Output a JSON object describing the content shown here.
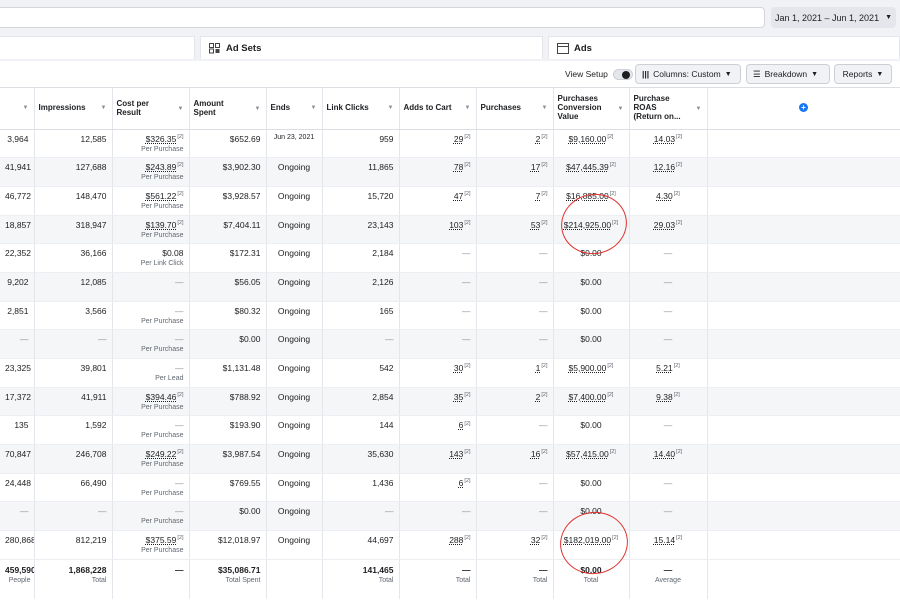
{
  "date_range": "Jan 1, 2021 – Jun 1, 2021",
  "tabs": {
    "ad_sets": "Ad Sets",
    "ads": "Ads"
  },
  "toolbar": {
    "view_setup": "View Setup",
    "columns": "Columns: Custom",
    "breakdown": "Breakdown",
    "reports": "Reports"
  },
  "headers": [
    "Impressions",
    "Cost per Result",
    "Amount Spent",
    "Ends",
    "Link Clicks",
    "Adds to Cart",
    "Purchases",
    "Purchases Conversion Value",
    "Purchase ROAS (Return on..."
  ],
  "rows": [
    {
      "reach": "3,964",
      "impr": "12,585",
      "cost": "$326.35",
      "cost_sup": "[2]",
      "cost_sub": "Per Purchase",
      "spent": "$652.69",
      "ends": "Jun 23, 2021",
      "clicks": "959",
      "atc": "29",
      "atc_sup": "[2]",
      "purch": "2",
      "purch_sup": "[2]",
      "pcv": "$9,160.00",
      "pcv_sup": "[2]",
      "roas": "14.03",
      "roas_sup": "[2]"
    },
    {
      "reach": "41,941",
      "impr": "127,688",
      "cost": "$243.89",
      "cost_sup": "[2]",
      "cost_sub": "Per Purchase",
      "spent": "$3,902.30",
      "ends": "Ongoing",
      "clicks": "11,865",
      "atc": "78",
      "atc_sup": "[2]",
      "purch": "17",
      "purch_sup": "[2]",
      "pcv": "$47,445.39",
      "pcv_sup": "[2]",
      "roas": "12.16",
      "roas_sup": "[2]"
    },
    {
      "reach": "46,772",
      "impr": "148,470",
      "cost": "$561.22",
      "cost_sup": "[2]",
      "cost_sub": "Per Purchase",
      "spent": "$3,928.57",
      "ends": "Ongoing",
      "clicks": "15,720",
      "atc": "47",
      "atc_sup": "[2]",
      "purch": "7",
      "purch_sup": "[2]",
      "pcv": "$16,885.00",
      "pcv_sup": "[2]",
      "roas": "4.30",
      "roas_sup": "[2]"
    },
    {
      "reach": "18,857",
      "impr": "318,947",
      "cost": "$139.70",
      "cost_sup": "[2]",
      "cost_sub": "Per Purchase",
      "spent": "$7,404.11",
      "ends": "Ongoing",
      "clicks": "23,143",
      "atc": "103",
      "atc_sup": "[2]",
      "purch": "53",
      "purch_sup": "[2]",
      "pcv": "$214,925.00",
      "pcv_sup": "[2]",
      "roas": "29.03",
      "roas_sup": "[2]"
    },
    {
      "reach": "22,352",
      "impr": "36,166",
      "cost": "$0.08",
      "cost_sup": "",
      "cost_sub": "Per Link Click",
      "spent": "$172.31",
      "ends": "Ongoing",
      "clicks": "2,184",
      "atc": "—",
      "atc_sup": "",
      "purch": "—",
      "purch_sup": "",
      "pcv": "$0.00",
      "pcv_sup": "",
      "roas": "—",
      "roas_sup": ""
    },
    {
      "reach": "9,202",
      "impr": "12,085",
      "cost": "—",
      "cost_sup": "",
      "cost_sub": "",
      "spent": "$56.05",
      "ends": "Ongoing",
      "clicks": "2,126",
      "atc": "—",
      "atc_sup": "",
      "purch": "—",
      "purch_sup": "",
      "pcv": "$0.00",
      "pcv_sup": "",
      "roas": "—",
      "roas_sup": ""
    },
    {
      "reach": "2,851",
      "impr": "3,566",
      "cost": "—",
      "cost_sup": "",
      "cost_sub": "Per Purchase",
      "spent": "$80.32",
      "ends": "Ongoing",
      "clicks": "165",
      "atc": "—",
      "atc_sup": "",
      "purch": "—",
      "purch_sup": "",
      "pcv": "$0.00",
      "pcv_sup": "",
      "roas": "—",
      "roas_sup": ""
    },
    {
      "reach": "—",
      "impr": "—",
      "cost": "—",
      "cost_sup": "",
      "cost_sub": "Per Purchase",
      "spent": "$0.00",
      "ends": "Ongoing",
      "clicks": "—",
      "atc": "—",
      "atc_sup": "",
      "purch": "—",
      "purch_sup": "",
      "pcv": "$0.00",
      "pcv_sup": "",
      "roas": "—",
      "roas_sup": ""
    },
    {
      "reach": "23,325",
      "impr": "39,801",
      "cost": "—",
      "cost_sup": "",
      "cost_sub": "Per Lead",
      "spent": "$1,131.48",
      "ends": "Ongoing",
      "clicks": "542",
      "atc": "30",
      "atc_sup": "[2]",
      "purch": "1",
      "purch_sup": "[2]",
      "pcv": "$5,900.00",
      "pcv_sup": "[2]",
      "roas": "5.21",
      "roas_sup": "[2]"
    },
    {
      "reach": "17,372",
      "impr": "41,911",
      "cost": "$394.46",
      "cost_sup": "[2]",
      "cost_sub": "Per Purchase",
      "spent": "$788.92",
      "ends": "Ongoing",
      "clicks": "2,854",
      "atc": "35",
      "atc_sup": "[2]",
      "purch": "2",
      "purch_sup": "[2]",
      "pcv": "$7,400.00",
      "pcv_sup": "[2]",
      "roas": "9.38",
      "roas_sup": "[2]"
    },
    {
      "reach": "135",
      "impr": "1,592",
      "cost": "—",
      "cost_sup": "",
      "cost_sub": "Per Purchase",
      "spent": "$193.90",
      "ends": "Ongoing",
      "clicks": "144",
      "atc": "6",
      "atc_sup": "[2]",
      "purch": "—",
      "purch_sup": "",
      "pcv": "$0.00",
      "pcv_sup": "",
      "roas": "—",
      "roas_sup": ""
    },
    {
      "reach": "70,847",
      "impr": "246,708",
      "cost": "$249.22",
      "cost_sup": "[2]",
      "cost_sub": "Per Purchase",
      "spent": "$3,987.54",
      "ends": "Ongoing",
      "clicks": "35,630",
      "atc": "143",
      "atc_sup": "[2]",
      "purch": "16",
      "purch_sup": "[2]",
      "pcv": "$57,415.00",
      "pcv_sup": "[2]",
      "roas": "14.40",
      "roas_sup": "[2]"
    },
    {
      "reach": "24,448",
      "impr": "66,490",
      "cost": "—",
      "cost_sup": "",
      "cost_sub": "Per Purchase",
      "spent": "$769.55",
      "ends": "Ongoing",
      "clicks": "1,436",
      "atc": "6",
      "atc_sup": "[2]",
      "purch": "—",
      "purch_sup": "",
      "pcv": "$0.00",
      "pcv_sup": "",
      "roas": "—",
      "roas_sup": ""
    },
    {
      "reach": "—",
      "impr": "—",
      "cost": "—",
      "cost_sup": "",
      "cost_sub": "Per Purchase",
      "spent": "$0.00",
      "ends": "Ongoing",
      "clicks": "—",
      "atc": "—",
      "atc_sup": "",
      "purch": "—",
      "purch_sup": "",
      "pcv": "$0.00",
      "pcv_sup": "",
      "roas": "—",
      "roas_sup": ""
    },
    {
      "reach": "280,868",
      "impr": "812,219",
      "cost": "$375.59",
      "cost_sup": "[2]",
      "cost_sub": "Per Purchase",
      "spent": "$12,018.97",
      "ends": "Ongoing",
      "clicks": "44,697",
      "atc": "288",
      "atc_sup": "[2]",
      "purch": "32",
      "purch_sup": "[2]",
      "pcv": "$182,019.00",
      "pcv_sup": "[2]",
      "roas": "15.14",
      "roas_sup": "[2]"
    }
  ],
  "totals": {
    "reach": "459,590",
    "reach_sub": "People",
    "impr": "1,868,228",
    "impr_sub": "Total",
    "cost": "—",
    "spent": "$35,086.71",
    "spent_sub": "Total Spent",
    "clicks": "141,465",
    "clicks_sub": "Total",
    "atc": "—",
    "atc_sub": "Total",
    "purch": "—",
    "purch_sub": "Total",
    "pcv": "$0.00",
    "pcv_sub": "Total",
    "roas": "—",
    "roas_sub": "Average"
  }
}
